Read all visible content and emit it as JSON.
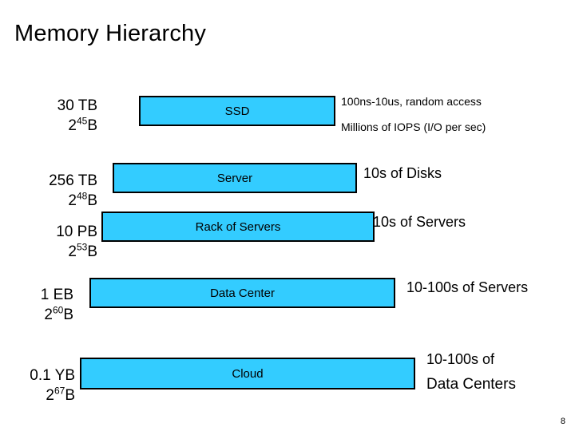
{
  "slide": {
    "title": "Memory Hierarchy",
    "page_number": "8",
    "accent_color": "#33CCFF",
    "border_color": "#000000",
    "background": "#ffffff"
  },
  "rows": [
    {
      "capacity_line1": "30 TB",
      "capacity_line2_base": "2",
      "capacity_line2_exp": "45",
      "capacity_line2_unit": "B",
      "bar_label": "SSD",
      "note_line1": "100ns-10us, random access",
      "note_line2": "Millions of IOPS (I/O per sec)"
    },
    {
      "capacity_line1": "256 TB",
      "capacity_line2_base": "2",
      "capacity_line2_exp": "48",
      "capacity_line2_unit": "B",
      "bar_label": "Server",
      "note_line1": "10s of Disks",
      "note_line2": ""
    },
    {
      "capacity_line1": "10 PB",
      "capacity_line2_base": "2",
      "capacity_line2_exp": "53",
      "capacity_line2_unit": "B",
      "bar_label": "Rack of Servers",
      "note_line1": "10s of Servers",
      "note_line2": ""
    },
    {
      "capacity_line1": "1 EB",
      "capacity_line2_base": "2",
      "capacity_line2_exp": "60",
      "capacity_line2_unit": "B",
      "bar_label": "Data Center",
      "note_line1": "10-100s of Servers",
      "note_line2": ""
    },
    {
      "capacity_line1": "0.1 YB",
      "capacity_line2_base": "2",
      "capacity_line2_exp": "67",
      "capacity_line2_unit": "B",
      "bar_label": "Cloud",
      "note_line1": "10-100s of",
      "note_line2": "Data Centers"
    }
  ]
}
